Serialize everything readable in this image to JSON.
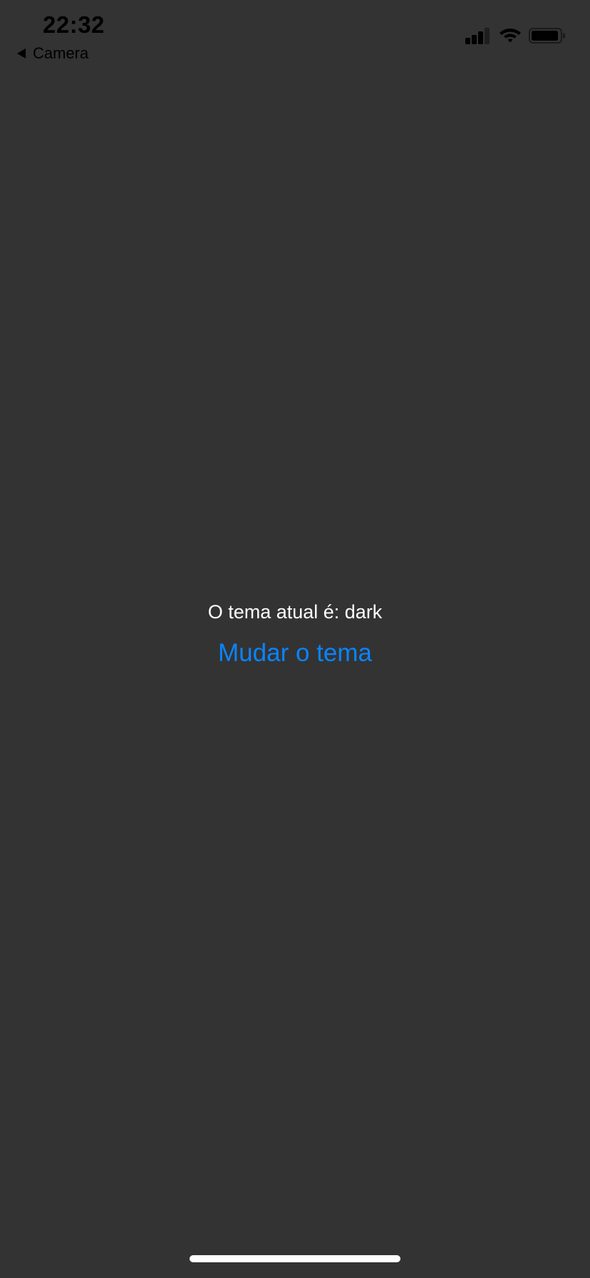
{
  "status_bar": {
    "time": "22:32",
    "back_label": "Camera",
    "icons": [
      "signal-icon",
      "wifi-icon",
      "battery-icon"
    ],
    "signal_bars_filled": 3,
    "signal_bars_total": 4,
    "battery_level": 0.95
  },
  "main": {
    "theme_text": "O tema atual é: dark",
    "change_button_label": "Mudar o tema"
  },
  "colors": {
    "background": "#333333",
    "text": "#ffffff",
    "accent": "#0a84ff",
    "status_bar_text": "#000000"
  }
}
